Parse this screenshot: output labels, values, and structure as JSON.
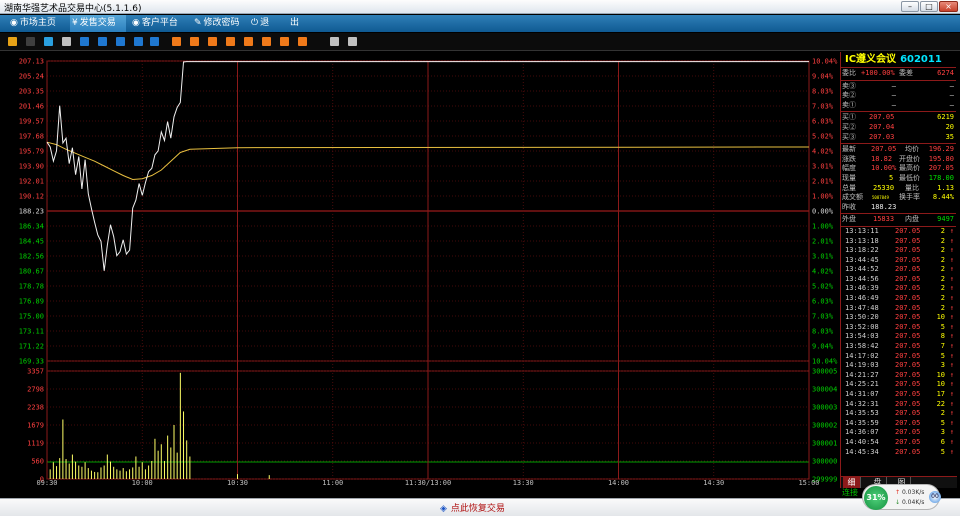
{
  "window": {
    "title": "湖南华强艺术品交易中心(5.1.1.6)",
    "controls": [
      "–",
      "□",
      "×"
    ]
  },
  "menu": [
    {
      "icon": "◉",
      "label": "市场主页",
      "active": false
    },
    {
      "icon": "¥",
      "label": "发售交易",
      "active": true
    },
    {
      "icon": "◉",
      "label": "客户平台",
      "active": false
    },
    {
      "icon": "✎",
      "label": "修改密码",
      "active": false
    },
    {
      "icon": "⏻",
      "label": "退",
      "active": false
    },
    {
      "icon": "",
      "label": "出",
      "active": false
    }
  ],
  "toolbar": {
    "colors": [
      "#e8a317",
      "#3f3f3f",
      "#2aa0e0",
      "#c0c0c0",
      "#1f78d1",
      "#1f78d1",
      "#1f78d1",
      "#1f78d1",
      "#1f78d1",
      "#f07a1a",
      "#f07a1a",
      "#f07a1a",
      "#f07a1a",
      "#f07a1a",
      "#f07a1a",
      "#f07a1a",
      "#f07a1a",
      "#c0c0c0",
      "#c0c0c0"
    ]
  },
  "stock": {
    "name": "IC遵义会议",
    "code": "602011"
  },
  "orderbook": {
    "ratio": {
      "label": "委比",
      "value": "+100.00%",
      "label2": "委差",
      "value2": "6274"
    },
    "sells": [
      {
        "label": "卖③",
        "price": "—",
        "vol": "—"
      },
      {
        "label": "卖②",
        "price": "—",
        "vol": "—"
      },
      {
        "label": "卖①",
        "price": "—",
        "vol": "—"
      }
    ],
    "buys": [
      {
        "label": "买①",
        "price": "207.05",
        "vol": "6219"
      },
      {
        "label": "买②",
        "price": "207.04",
        "vol": "20"
      },
      {
        "label": "买③",
        "price": "207.03",
        "vol": "35"
      }
    ]
  },
  "quote": [
    {
      "l1": "最新",
      "v1": "207.05",
      "l2": "均价",
      "v2": "196.29"
    },
    {
      "l1": "涨跌",
      "v1": "18.82",
      "l2": "开盘价",
      "v2": "195.80"
    },
    {
      "l1": "幅度",
      "v1": "10.00%",
      "l2": "最高价",
      "v2": "207.05"
    },
    {
      "l1": "现量",
      "v1": "5",
      "l2": "最低价",
      "v2": "178.00"
    },
    {
      "l1": "总量",
      "v1": "25330",
      "l2": "量比",
      "v2": "1.13"
    },
    {
      "l1": "成交额",
      "v1": "5087849",
      "l2": "换手率",
      "v2": "8.44%"
    },
    {
      "l1": "昨收",
      "v1": "188.23",
      "l2": "",
      "v2": ""
    }
  ],
  "volume_split": {
    "l1": "外盘",
    "v1": "15833",
    "l2": "内盘",
    "v2": "9497"
  },
  "ticks": [
    {
      "time": "13:13:11",
      "price": "207.05",
      "vol": "2"
    },
    {
      "time": "13:13:18",
      "price": "207.05",
      "vol": "2"
    },
    {
      "time": "13:18:22",
      "price": "207.05",
      "vol": "2"
    },
    {
      "time": "13:44:45",
      "price": "207.05",
      "vol": "2"
    },
    {
      "time": "13:44:52",
      "price": "207.05",
      "vol": "2"
    },
    {
      "time": "13:44:56",
      "price": "207.05",
      "vol": "2"
    },
    {
      "time": "13:46:39",
      "price": "207.05",
      "vol": "2"
    },
    {
      "time": "13:46:49",
      "price": "207.05",
      "vol": "2"
    },
    {
      "time": "13:47:48",
      "price": "207.05",
      "vol": "2"
    },
    {
      "time": "13:50:20",
      "price": "207.05",
      "vol": "10"
    },
    {
      "time": "13:52:08",
      "price": "207.05",
      "vol": "5"
    },
    {
      "time": "13:54:03",
      "price": "207.05",
      "vol": "8"
    },
    {
      "time": "13:58:42",
      "price": "207.05",
      "vol": "7"
    },
    {
      "time": "14:17:02",
      "price": "207.05",
      "vol": "5"
    },
    {
      "time": "14:19:03",
      "price": "207.05",
      "vol": "3"
    },
    {
      "time": "14:21:27",
      "price": "207.05",
      "vol": "10"
    },
    {
      "time": "14:25:21",
      "price": "207.05",
      "vol": "10"
    },
    {
      "time": "14:31:07",
      "price": "207.05",
      "vol": "17"
    },
    {
      "time": "14:32:31",
      "price": "207.05",
      "vol": "22"
    },
    {
      "time": "14:35:53",
      "price": "207.05",
      "vol": "2"
    },
    {
      "time": "14:35:59",
      "price": "207.05",
      "vol": "5"
    },
    {
      "time": "14:36:07",
      "price": "207.05",
      "vol": "3"
    },
    {
      "time": "14:40:54",
      "price": "207.05",
      "vol": "6"
    },
    {
      "time": "14:45:34",
      "price": "207.05",
      "vol": "5"
    }
  ],
  "side_tabs": [
    "细",
    "盘",
    "图"
  ],
  "status": {
    "resume_label": "点此恢复交易",
    "connection": "连接",
    "net_percent": "31%",
    "net_up": "0.03K/s",
    "net_down": "0.04K/s",
    "badge": "00"
  },
  "chart_data": {
    "type": "line",
    "prev_close": 188.23,
    "price_axis": {
      "labels": [
        "207.13",
        "205.24",
        "203.35",
        "201.46",
        "199.57",
        "197.68",
        "195.79",
        "193.90",
        "192.01",
        "190.12",
        "188.23",
        "186.34",
        "184.45",
        "182.56",
        "180.67",
        "178.78",
        "176.89",
        "175.00",
        "173.11",
        "171.22",
        "169.33"
      ],
      "pct_labels": [
        "10.04%",
        "9.04%",
        "8.03%",
        "7.03%",
        "6.03%",
        "5.02%",
        "4.02%",
        "3.01%",
        "2.01%",
        "1.00%",
        "0.00%",
        "1.00%",
        "2.01%",
        "3.01%",
        "4.02%",
        "5.02%",
        "6.03%",
        "7.03%",
        "8.03%",
        "9.04%",
        "10.04%"
      ],
      "ylim": [
        169.33,
        207.13
      ]
    },
    "volume_axis": {
      "labels": [
        "3357",
        "2798",
        "2238",
        "1679",
        "1119",
        "560",
        "0"
      ],
      "right_labels": [
        "300005",
        "300004",
        "300003",
        "300002",
        "300001",
        "300000",
        "299999"
      ],
      "ylim": [
        0,
        3357
      ]
    },
    "time_labels": [
      "09:30",
      "10:00",
      "10:30",
      "11:00",
      "11:30/13:00",
      "13:30",
      "14:00",
      "14:30",
      "15:00"
    ],
    "x_minutes_range": [
      0,
      240
    ],
    "price_series": {
      "name": "价格",
      "x": [
        0,
        1,
        2,
        3,
        4,
        5,
        6,
        7,
        8,
        9,
        10,
        11,
        12,
        13,
        14,
        15,
        16,
        17,
        18,
        19,
        20,
        21,
        22,
        23,
        24,
        25,
        26,
        27,
        28,
        29,
        30,
        31,
        32,
        33,
        34,
        35,
        36,
        37,
        38,
        39,
        40,
        41,
        42,
        43,
        44,
        240
      ],
      "y": [
        196.9,
        196.3,
        194.5,
        195.8,
        201.5,
        196.8,
        197.4,
        194.2,
        196.2,
        192.8,
        195.1,
        191.0,
        194.7,
        190.4,
        188.5,
        186.8,
        185.2,
        184.4,
        180.7,
        183.9,
        186.5,
        185.0,
        182.6,
        183.1,
        184.6,
        182.8,
        183.3,
        188.6,
        189.6,
        191.7,
        190.2,
        191.8,
        193.2,
        193.6,
        195.3,
        195.8,
        198.2,
        197.1,
        199.5,
        197.4,
        200.1,
        201.3,
        201.9,
        207.0,
        207.05,
        207.05
      ]
    },
    "avg_series": {
      "name": "均价",
      "x": [
        0,
        3,
        6,
        9,
        12,
        15,
        18,
        21,
        24,
        27,
        30,
        33,
        36,
        39,
        42,
        45,
        60,
        240
      ],
      "y": [
        196.9,
        196.6,
        196.0,
        195.5,
        195.0,
        194.5,
        193.9,
        193.3,
        192.7,
        192.2,
        192.3,
        192.7,
        193.4,
        194.5,
        195.6,
        196.0,
        196.2,
        196.29
      ]
    },
    "volume_series": {
      "name": "成交量",
      "x": [
        1,
        2,
        3,
        4,
        5,
        6,
        7,
        8,
        9,
        10,
        11,
        12,
        13,
        14,
        15,
        16,
        17,
        18,
        19,
        20,
        21,
        22,
        23,
        24,
        25,
        26,
        27,
        28,
        29,
        30,
        31,
        32,
        33,
        34,
        35,
        36,
        37,
        38,
        39,
        40,
        41,
        42,
        43,
        44,
        45,
        60,
        70
      ],
      "y": [
        300,
        520,
        400,
        650,
        1850,
        620,
        480,
        760,
        540,
        420,
        380,
        520,
        340,
        260,
        220,
        210,
        360,
        420,
        760,
        540,
        380,
        300,
        260,
        340,
        240,
        300,
        360,
        700,
        380,
        520,
        300,
        420,
        560,
        1250,
        880,
        1080,
        560,
        1350,
        980,
        1680,
        820,
        3300,
        2100,
        1200,
        700,
        150,
        120
      ]
    }
  }
}
